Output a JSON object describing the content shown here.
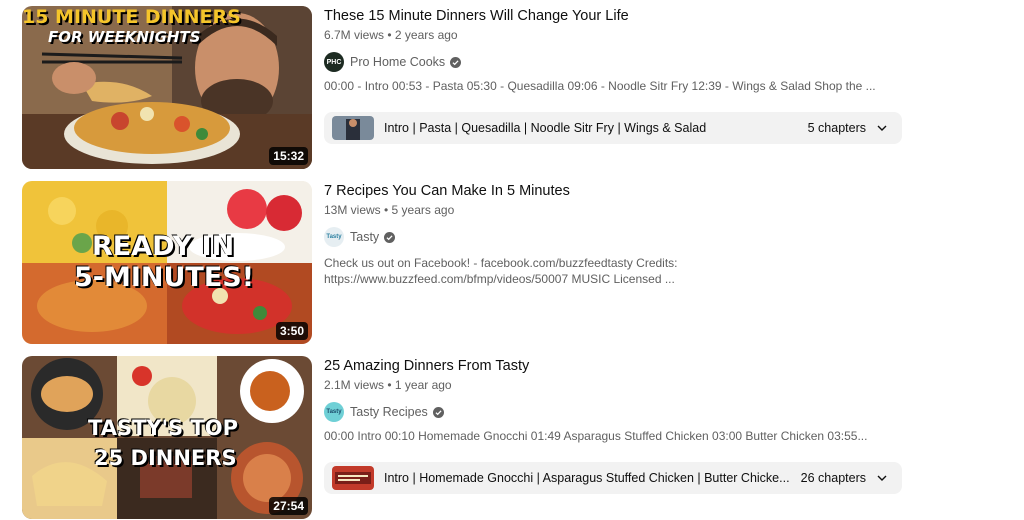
{
  "results": [
    {
      "title": "These 15 Minute Dinners Will Change Your Life",
      "meta": "6.7M views • 2 years ago",
      "channel": "Pro Home Cooks",
      "channel_avatar_text": "PHC",
      "description": "00:00 - Intro 00:53 - Pasta 05:30 - Quesadilla 09:06 - Noodle Sitr Fry 12:39 - Wings & Salad Shop the ...",
      "duration": "15:32",
      "thumb_text_1": "15 MINUTE DINNERS",
      "thumb_text_2": "FOR WEEKNIGHTS",
      "chapters_list": "Intro | Pasta | Quesadilla | Noodle Sitr Fry | Wings & Salad",
      "chapters_count": "5 chapters"
    },
    {
      "title": "7 Recipes You Can Make In 5 Minutes",
      "meta": "13M views • 5 years ago",
      "channel": "Tasty",
      "channel_avatar_text": "Tasty",
      "description": "Check us out on Facebook! - facebook.com/buzzfeedtasty Credits: https://www.buzzfeed.com/bfmp/videos/50007 MUSIC Licensed ...",
      "duration": "3:50",
      "thumb_text_1": "READY IN",
      "thumb_text_2": "5-MINUTES!"
    },
    {
      "title": "25 Amazing Dinners From Tasty",
      "meta": "2.1M views • 1 year ago",
      "channel": "Tasty Recipes",
      "channel_avatar_text": "Tasty",
      "description": "00:00 Intro 00:10 Homemade Gnocchi 01:49 Asparagus Stuffed Chicken 03:00 Butter Chicken 03:55...",
      "duration": "27:54",
      "thumb_text_1": "TASTY'S TOP",
      "thumb_text_2": "25 DINNERS",
      "chapters_list": "Intro | Homemade Gnocchi | Asparagus Stuffed Chicken | Butter Chicke...",
      "chapters_count": "26 chapters"
    }
  ],
  "icons": {
    "verified": "verified-check-icon",
    "chevron": "chevron-down-icon"
  },
  "colors": {
    "title": "#0f0f0f",
    "secondary": "#606060",
    "chapters_bg": "#f2f2f2",
    "thumb1_text": "#f5c52a"
  }
}
